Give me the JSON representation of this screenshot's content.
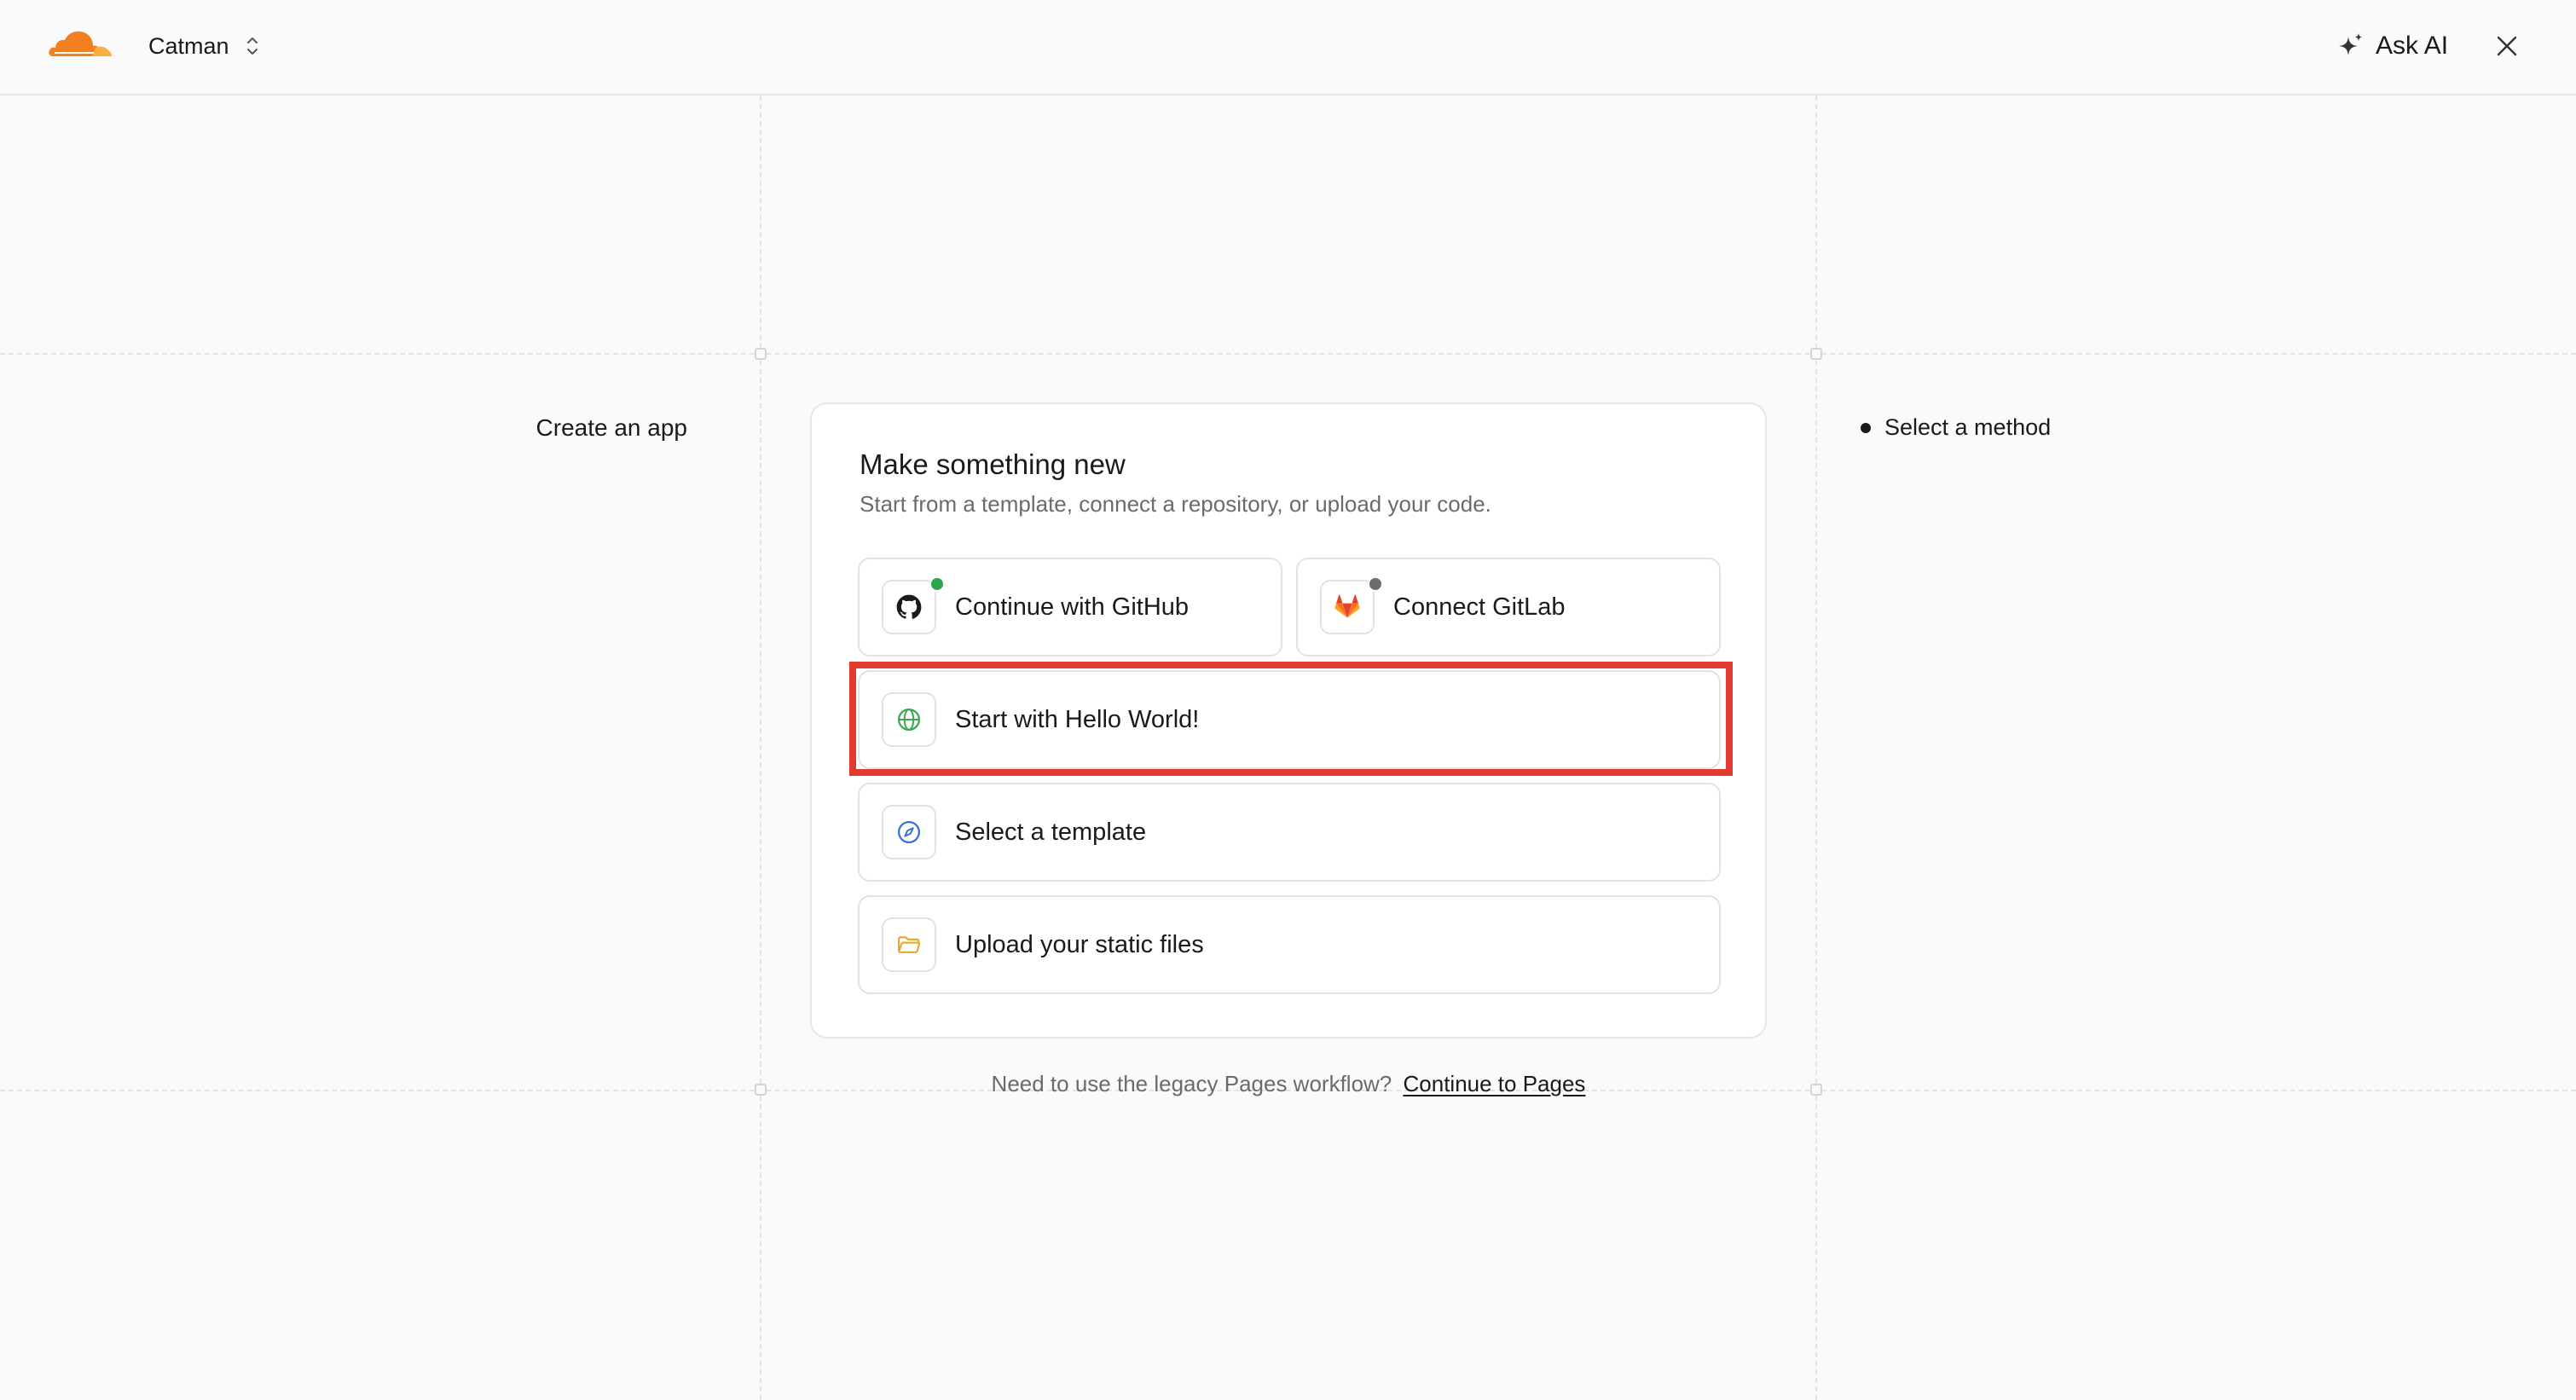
{
  "header": {
    "account_name": "Catman",
    "ask_ai_label": "Ask AI"
  },
  "section_label": "Create an app",
  "step": {
    "label": "Select a method"
  },
  "card": {
    "title": "Make something new",
    "subtitle": "Start from a template, connect a repository, or upload your code.",
    "options": [
      {
        "label": "Continue with GitHub",
        "icon": "github-icon",
        "status": "connected",
        "status_color": "#2da44e"
      },
      {
        "label": "Connect GitLab",
        "icon": "gitlab-icon",
        "status": "disconnected",
        "status_color": "#6b6b6b"
      },
      {
        "label": "Start with Hello World!",
        "icon": "globe-icon",
        "highlighted": true
      },
      {
        "label": "Select a template",
        "icon": "compass-icon"
      },
      {
        "label": "Upload your static files",
        "icon": "folder-icon"
      }
    ]
  },
  "legacy": {
    "text": "Need to use the legacy Pages workflow?",
    "link_label": "Continue to Pages"
  },
  "colors": {
    "brand_orange": "#f38020",
    "highlight_red": "#e23b2e",
    "globe_green": "#3aa755",
    "compass_blue": "#3b6ed6",
    "folder_yellow": "#e2a72e"
  }
}
